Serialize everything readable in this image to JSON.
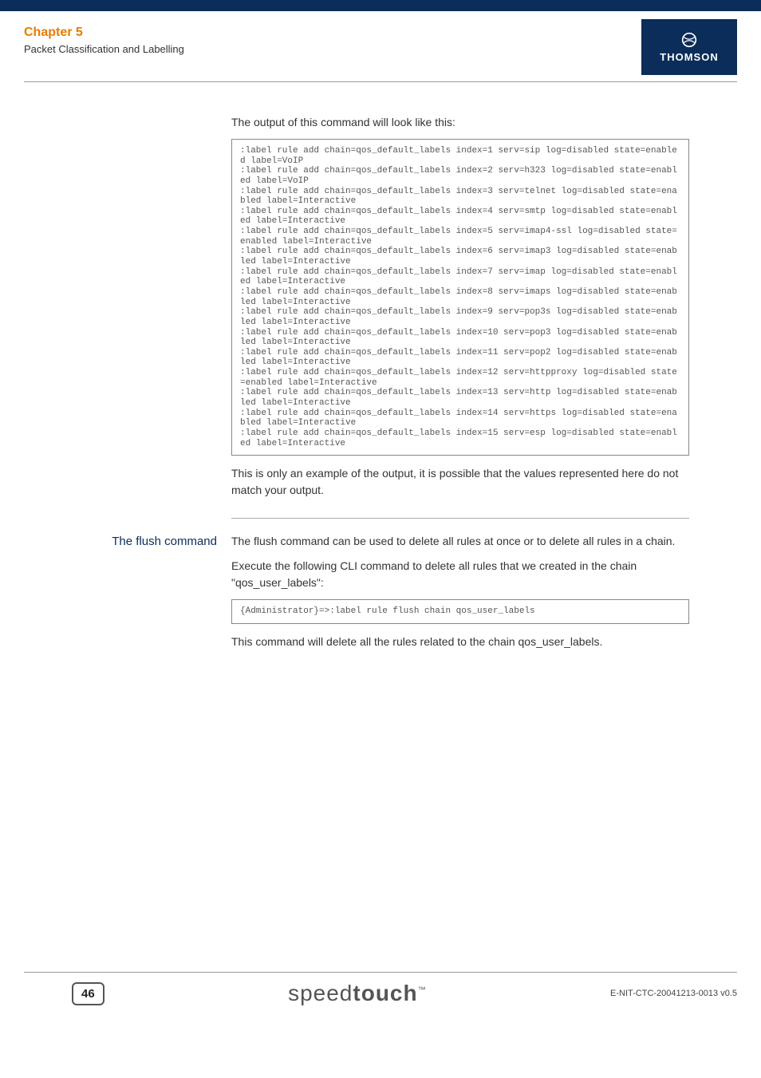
{
  "header": {
    "chapter": "Chapter 5",
    "subtitle": "Packet Classification and Labelling",
    "logo_text": "THOMSON"
  },
  "intro_text": "The output of this command will look like this:",
  "code_block_1": ":label rule add chain=qos_default_labels index=1 serv=sip log=disabled state=enabled label=VoIP\n:label rule add chain=qos_default_labels index=2 serv=h323 log=disabled state=enabled label=VoIP\n:label rule add chain=qos_default_labels index=3 serv=telnet log=disabled state=enabled label=Interactive\n:label rule add chain=qos_default_labels index=4 serv=smtp log=disabled state=enabled label=Interactive\n:label rule add chain=qos_default_labels index=5 serv=imap4-ssl log=disabled state=enabled label=Interactive\n:label rule add chain=qos_default_labels index=6 serv=imap3 log=disabled state=enabled label=Interactive\n:label rule add chain=qos_default_labels index=7 serv=imap log=disabled state=enabled label=Interactive\n:label rule add chain=qos_default_labels index=8 serv=imaps log=disabled state=enabled label=Interactive\n:label rule add chain=qos_default_labels index=9 serv=pop3s log=disabled state=enabled label=Interactive\n:label rule add chain=qos_default_labels index=10 serv=pop3 log=disabled state=enabled label=Interactive\n:label rule add chain=qos_default_labels index=11 serv=pop2 log=disabled state=enabled label=Interactive\n:label rule add chain=qos_default_labels index=12 serv=httpproxy log=disabled state=enabled label=Interactive\n:label rule add chain=qos_default_labels index=13 serv=http log=disabled state=enabled label=Interactive\n:label rule add chain=qos_default_labels index=14 serv=https log=disabled state=enabled label=Interactive\n:label rule add chain=qos_default_labels index=15 serv=esp log=disabled state=enabled label=Interactive",
  "note_text": "This is only an example of the output, it is possible that the values represented here do not match your output.",
  "flush": {
    "heading": "The flush command",
    "p1": "The flush command can be used to delete all rules at once or to delete all rules in a chain.",
    "p2": "Execute the following CLI command to delete all rules that we created in the chain \"qos_user_labels\":",
    "code": "{Administrator}=>:label rule flush chain qos_user_labels",
    "p3": "This command will delete all the rules related to the chain qos_user_labels."
  },
  "footer": {
    "page": "46",
    "brand_thin": "speed",
    "brand_bold": "touch",
    "brand_tm": "™",
    "docid": "E-NIT-CTC-20041213-0013 v0.5"
  }
}
